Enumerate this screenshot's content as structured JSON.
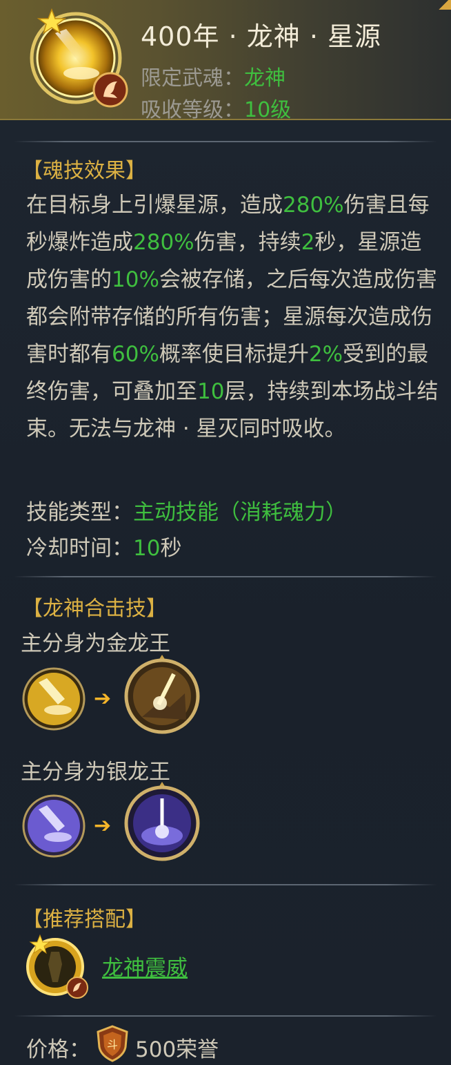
{
  "header": {
    "title": "400年 · 龙神 · 星源",
    "restrict_label": "限定武魂：",
    "restrict_value": "龙神",
    "absorb_label": "吸收等级：",
    "absorb_value": "10级"
  },
  "effect": {
    "section_title": "【魂技效果】",
    "segments": [
      {
        "t": "在目标身上引爆星源，造成"
      },
      {
        "t": "280%",
        "g": true
      },
      {
        "t": "伤害且每秒爆炸造成"
      },
      {
        "t": "280%",
        "g": true
      },
      {
        "t": "伤害，持续"
      },
      {
        "t": "2",
        "g": true
      },
      {
        "t": "秒，星源造成伤害的"
      },
      {
        "t": "10%",
        "g": true
      },
      {
        "t": "会被存储，之后每次造成伤害都会附带存储的所有伤害；星源每次造成伤害时都有"
      },
      {
        "t": "60%",
        "g": true
      },
      {
        "t": "概率使目标提升"
      },
      {
        "t": "2%",
        "g": true
      },
      {
        "t": "受到的最终伤害，可叠加至"
      },
      {
        "t": "10",
        "g": true
      },
      {
        "t": "层，持续到本场战斗结束。无法与龙神 · 星灭同时吸收。"
      }
    ],
    "skill_type_label": "技能类型：",
    "skill_type_value": "主动技能（消耗魂力）",
    "cooldown_label": "冷却时间：",
    "cooldown_value": "10",
    "cooldown_unit": "秒"
  },
  "combo": {
    "section_title": "【龙神合击技】",
    "gold_label": "主分身为金龙王",
    "silver_label": "主分身为银龙王",
    "arrow": "➔"
  },
  "recommend": {
    "section_title": "【推荐搭配】",
    "item_name": "龙神震威"
  },
  "price": {
    "label": "价格：",
    "value": "500荣誉"
  },
  "colors": {
    "accent_gold": "#dcb143",
    "value_green": "#3fbf3f",
    "arrow_orange": "#f5b52a"
  }
}
